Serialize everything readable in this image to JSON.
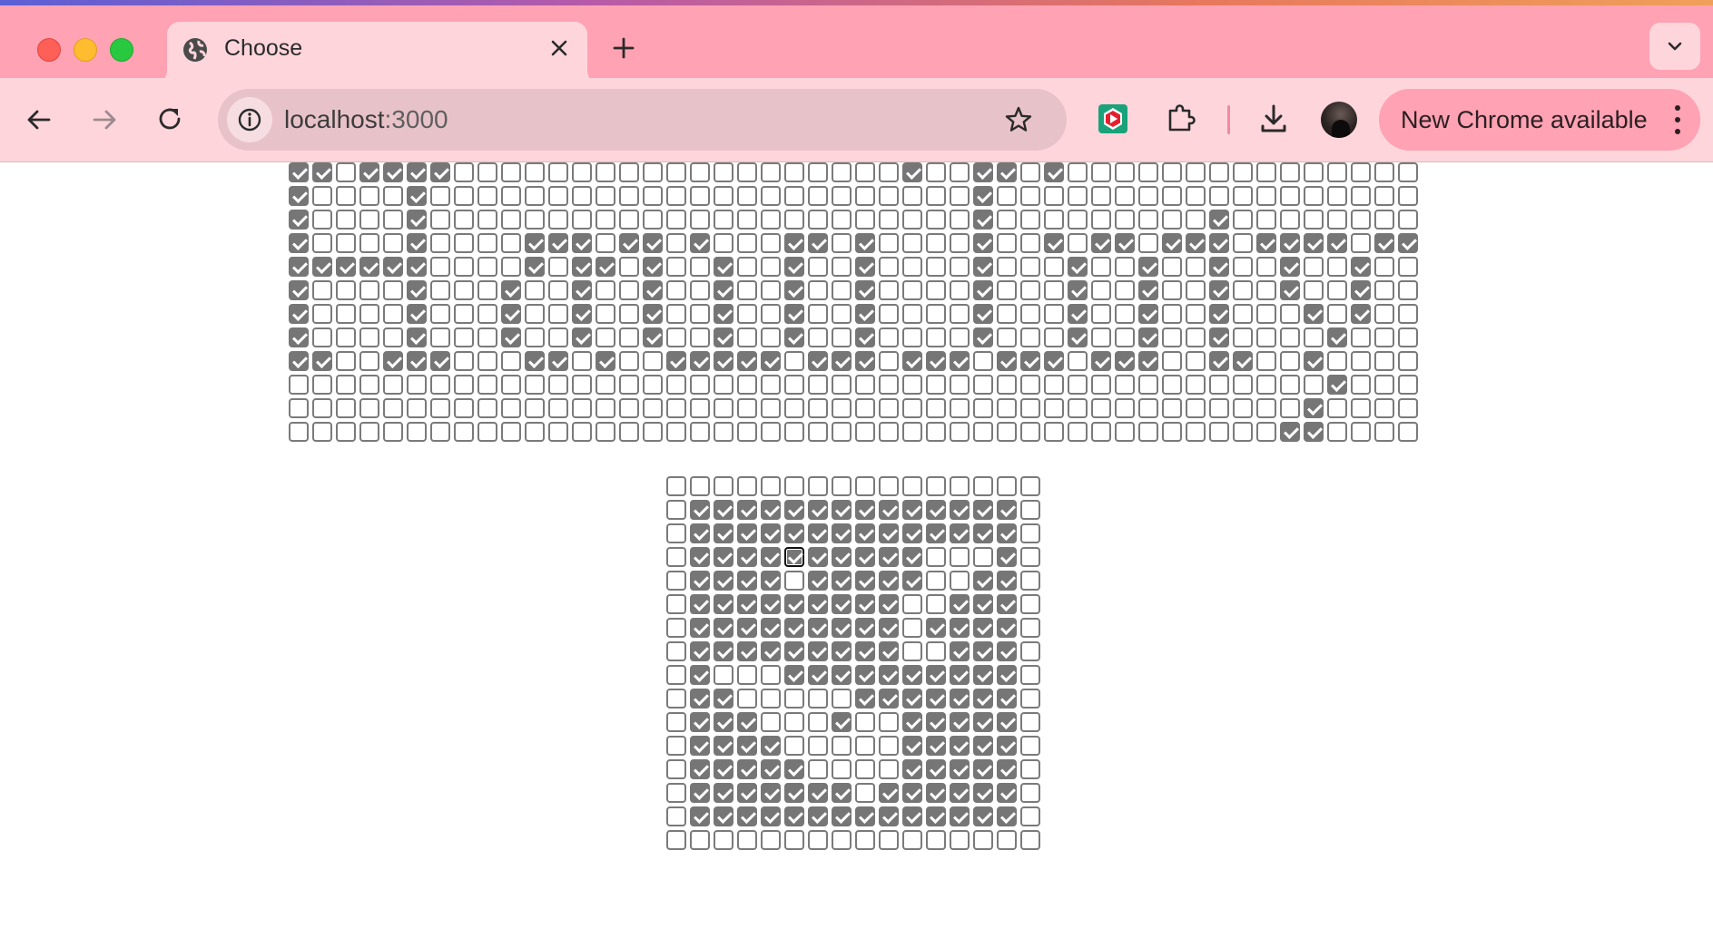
{
  "browser": {
    "tab_title": "Choose",
    "url_host": "localhost",
    "url_port": ":3000",
    "update_label": "New Chrome available",
    "icons": {
      "tab_favicon": "globe-icon",
      "close": "close-icon",
      "new_tab": "plus-icon",
      "tab_search": "chevron-down-icon",
      "back": "back-arrow-icon",
      "forward": "forward-arrow-icon",
      "reload": "reload-icon",
      "site_info": "info-icon",
      "bookmark": "star-icon",
      "extension": "youtube-extension-icon",
      "extensions_menu": "puzzle-icon",
      "downloads": "download-icon",
      "profile": "avatar",
      "menu": "kebab-menu-icon"
    },
    "colors": {
      "titlebar": "#ffa2b3",
      "toolbar": "#ffd5dc",
      "checked": "#767676"
    }
  },
  "page": {
    "text_grid": {
      "cols": 48,
      "rows": [
        "110111100000000000000000001001101000000000000000",
        "100001000000000000000000000001000000000000000000",
        "100001000000000000000000000001000000000100000000",
        "100001000011101101000110100001001011011101111011",
        "111111000010110100100100100001000100100100100100",
        "100001000100100100100100100001000100100100100100",
        "100001000100100100100100100001000100100100010100",
        "100001000100100100100100100001000100100100001000",
        "110011100011010011111011101110111011100110010000",
        "000000000000000000000000000000000000000000001000",
        "000000000000000000000000000000000000000000010000",
        "000000000000000000000000000000000000000000110000"
      ]
    },
    "icon_grid": {
      "cols": 16,
      "focus": "3,5",
      "rows": [
        "0000000000000000",
        "0111111111111110",
        "0111111111111110",
        "0111111111100010",
        "0111101111100110",
        "0111111111001110",
        "0111111111011110",
        "0111111111001110",
        "0100011111111110",
        "0110000011111110",
        "0111000100111110",
        "0111100000111110",
        "0111110000111110",
        "0111111101111110",
        "0111111111111110",
        "0000000000000000"
      ]
    }
  }
}
